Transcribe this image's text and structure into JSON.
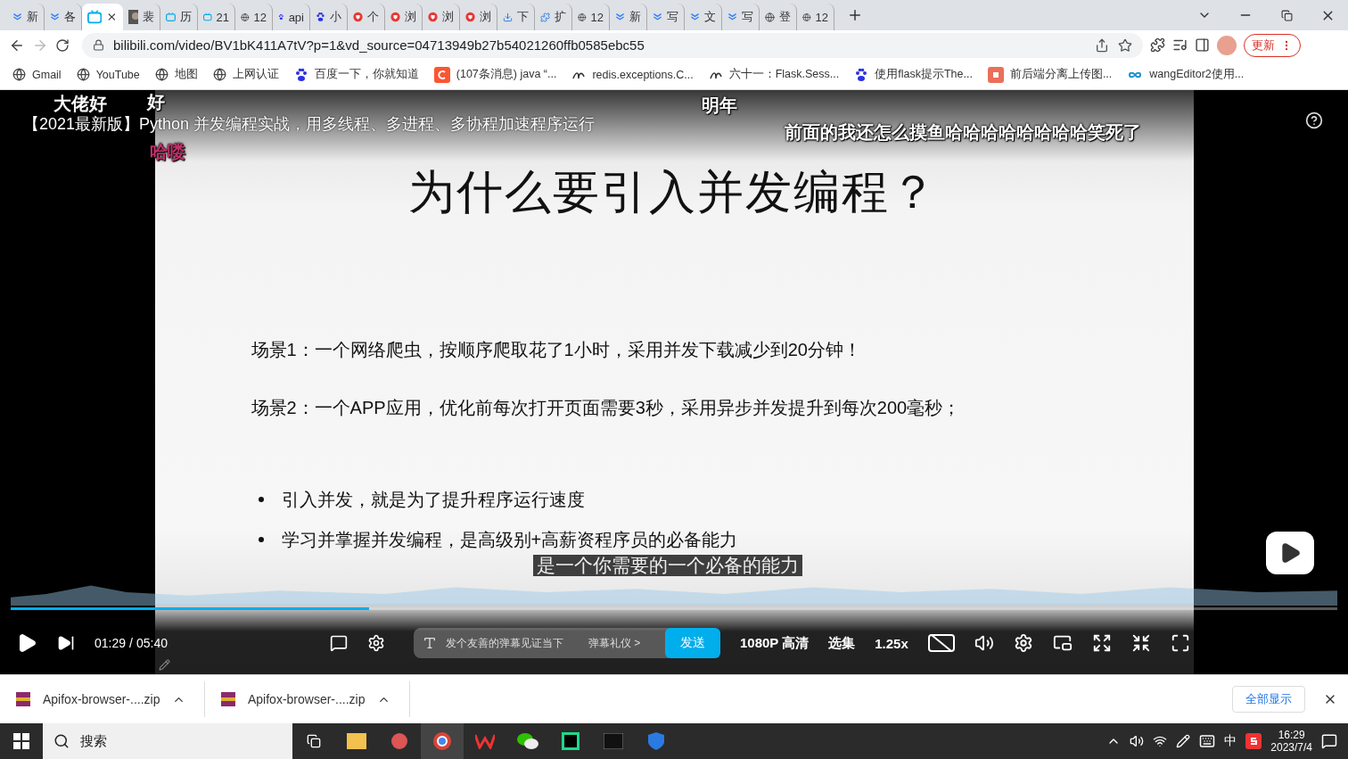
{
  "browser": {
    "tabs": [
      {
        "title": "新",
        "selected": false
      },
      {
        "title": "各",
        "selected": false
      },
      {
        "selected": true
      },
      {
        "title": "裴",
        "selected": false
      },
      {
        "title": "历",
        "selected": false
      },
      {
        "title": "21",
        "selected": false
      },
      {
        "title": "12",
        "selected": false
      },
      {
        "title": "api",
        "selected": false
      },
      {
        "title": "小",
        "selected": false
      },
      {
        "title": "个",
        "selected": false
      },
      {
        "title": "浏",
        "selected": false
      },
      {
        "title": "浏",
        "selected": false
      },
      {
        "title": "浏",
        "selected": false
      },
      {
        "title": "下",
        "selected": false
      },
      {
        "title": "扩",
        "selected": false
      },
      {
        "title": "12",
        "selected": false
      },
      {
        "title": "新",
        "selected": false
      },
      {
        "title": "写",
        "selected": false
      },
      {
        "title": "文",
        "selected": false
      },
      {
        "title": "写",
        "selected": false
      },
      {
        "title": "登",
        "selected": false
      },
      {
        "title": "12",
        "selected": false
      }
    ],
    "url": "bilibili.com/video/BV1bK411A7tV?p=1&vd_source=04713949b27b54021260ffb0585ebc55",
    "update_button": "更新"
  },
  "bookmarks": [
    {
      "label": "Gmail"
    },
    {
      "label": "YouTube"
    },
    {
      "label": "地图"
    },
    {
      "label": "上网认证"
    },
    {
      "label": "百度一下，你就知道"
    },
    {
      "label": "(107条消息) java “..."
    },
    {
      "label": "redis.exceptions.C..."
    },
    {
      "label": "六十一：Flask.Sess..."
    },
    {
      "label": "使用flask提示The..."
    },
    {
      "label": "前后端分离上传图..."
    },
    {
      "label": "wangEditor2使用..."
    }
  ],
  "video": {
    "title": "【2021最新版】Python 并发编程实战，用多线程、多进程、多协程加速程序运行",
    "danmaku": [
      {
        "text": "大佬好"
      },
      {
        "text": "好"
      },
      {
        "text": "哈喽",
        "color": "#c0306a"
      },
      {
        "text": "明年"
      },
      {
        "text": "前面的我还怎么摸鱼哈哈哈哈哈哈哈哈笑死了"
      }
    ],
    "slide": {
      "heading": "为什么要引入并发编程？",
      "scenes": [
        "场景1：一个网络爬虫，按顺序爬取花了1小时，采用并发下载减少到20分钟！",
        "场景2：一个APP应用，优化前每次打开页面需要3秒，采用异步并发提升到每次200毫秒；"
      ],
      "bullets": [
        "引入并发，就是为了提升程序运行速度",
        "学习并掌握并发编程，是高级别+高薪资程序员的必备能力"
      ]
    },
    "subtitle": "是一个你需要的一个必备的能力",
    "progress": {
      "level": 0.27
    },
    "time_current": "01:29",
    "time_separator": "/",
    "time_total": "05:40",
    "danmaku_placeholder": "发个友善的弹幕见证当下",
    "etiquette": "弹幕礼仪 >",
    "send": "发送",
    "quality": "1080P 高清",
    "episodes": "选集",
    "speed": "1.25x"
  },
  "downloads": {
    "items": [
      {
        "name": "Apifox-browser-....zip"
      },
      {
        "name": "Apifox-browser-....zip"
      }
    ],
    "show_all": "全部显示"
  },
  "taskbar": {
    "search": "搜索",
    "ime": "中",
    "time": "16:29",
    "date": "2023/7/4"
  }
}
